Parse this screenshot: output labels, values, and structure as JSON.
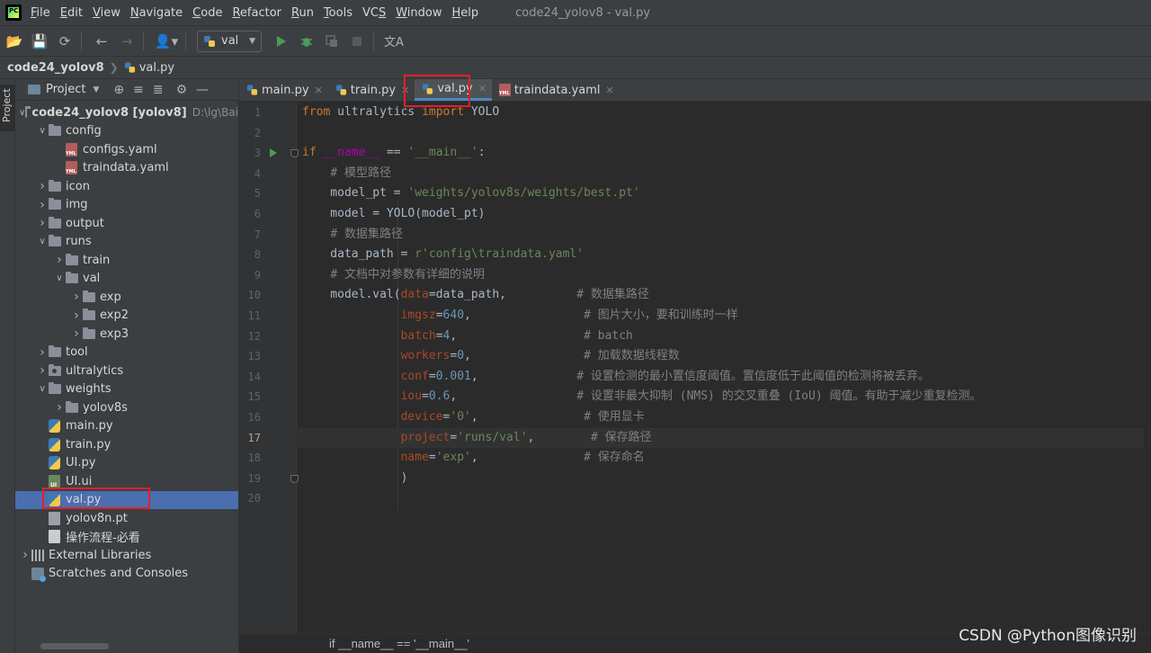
{
  "app": {
    "window_title": "code24_yolov8 - val.py"
  },
  "menu": {
    "items": [
      {
        "label": "File",
        "mn": "F",
        "rest": "ile"
      },
      {
        "label": "Edit",
        "mn": "E",
        "rest": "dit"
      },
      {
        "label": "View",
        "mn": "V",
        "rest": "iew"
      },
      {
        "label": "Navigate",
        "mn": "N",
        "rest": "avigate"
      },
      {
        "label": "Code",
        "mn": "C",
        "rest": "ode"
      },
      {
        "label": "Refactor",
        "mn": "R",
        "rest": "efactor"
      },
      {
        "label": "Run",
        "mn": "R",
        "rest": "un"
      },
      {
        "label": "Tools",
        "mn": "T",
        "rest": "ools"
      },
      {
        "label": "VCS",
        "mn": "S",
        "rest": "VC"
      },
      {
        "label": "Window",
        "mn": "W",
        "rest": "indow"
      },
      {
        "label": "Help",
        "mn": "H",
        "rest": "elp"
      }
    ]
  },
  "toolbar": {
    "run_config": "val"
  },
  "breadcrumb": {
    "project": "code24_yolov8",
    "file": "val.py"
  },
  "left_strip": {
    "project_label": "Project"
  },
  "project_panel": {
    "title": "Project",
    "tree": [
      {
        "label": "code24_yolov8 [yolov8]",
        "path": "D:\\lg\\Bai",
        "depth": 0,
        "arrow": "open",
        "icon": "folder",
        "bold": true
      },
      {
        "label": "config",
        "depth": 1,
        "arrow": "open",
        "icon": "folder"
      },
      {
        "label": "configs.yaml",
        "depth": 2,
        "arrow": "none",
        "icon": "yaml"
      },
      {
        "label": "traindata.yaml",
        "depth": 2,
        "arrow": "none",
        "icon": "yaml"
      },
      {
        "label": "icon",
        "depth": 1,
        "arrow": "closed",
        "icon": "folder"
      },
      {
        "label": "img",
        "depth": 1,
        "arrow": "closed",
        "icon": "folder"
      },
      {
        "label": "output",
        "depth": 1,
        "arrow": "closed",
        "icon": "folder"
      },
      {
        "label": "runs",
        "depth": 1,
        "arrow": "open",
        "icon": "folder"
      },
      {
        "label": "train",
        "depth": 2,
        "arrow": "closed",
        "icon": "folder"
      },
      {
        "label": "val",
        "depth": 2,
        "arrow": "open",
        "icon": "folder"
      },
      {
        "label": "exp",
        "depth": 3,
        "arrow": "closed",
        "icon": "folder"
      },
      {
        "label": "exp2",
        "depth": 3,
        "arrow": "closed",
        "icon": "folder"
      },
      {
        "label": "exp3",
        "depth": 3,
        "arrow": "closed",
        "icon": "folder"
      },
      {
        "label": "tool",
        "depth": 1,
        "arrow": "closed",
        "icon": "folder"
      },
      {
        "label": "ultralytics",
        "depth": 1,
        "arrow": "closed",
        "icon": "package"
      },
      {
        "label": "weights",
        "depth": 1,
        "arrow": "open",
        "icon": "folder"
      },
      {
        "label": "yolov8s",
        "depth": 2,
        "arrow": "closed",
        "icon": "folder"
      },
      {
        "label": "main.py",
        "depth": 1,
        "arrow": "none",
        "icon": "py"
      },
      {
        "label": "train.py",
        "depth": 1,
        "arrow": "none",
        "icon": "py"
      },
      {
        "label": "UI.py",
        "depth": 1,
        "arrow": "none",
        "icon": "py"
      },
      {
        "label": "UI.ui",
        "depth": 1,
        "arrow": "none",
        "icon": "ui"
      },
      {
        "label": "val.py",
        "depth": 1,
        "arrow": "none",
        "icon": "py",
        "selected": true
      },
      {
        "label": "yolov8n.pt",
        "depth": 1,
        "arrow": "none",
        "icon": "bin"
      },
      {
        "label": "操作流程-必看",
        "depth": 1,
        "arrow": "none",
        "icon": "txt"
      },
      {
        "label": "External Libraries",
        "depth": 0,
        "arrow": "closed",
        "icon": "lib"
      },
      {
        "label": "Scratches and Consoles",
        "depth": 0,
        "arrow": "none",
        "icon": "scratch"
      }
    ]
  },
  "editor": {
    "tabs": [
      {
        "label": "main.py",
        "icon": "py",
        "active": false
      },
      {
        "label": "train.py",
        "icon": "py",
        "active": false
      },
      {
        "label": "val.py",
        "icon": "py",
        "active": true
      },
      {
        "label": "traindata.yaml",
        "icon": "yaml",
        "active": false
      }
    ],
    "current_line": 17,
    "line_count": 20,
    "lines": [
      [
        {
          "t": "from ",
          "c": "kw"
        },
        {
          "t": "ultralytics "
        },
        {
          "t": "import ",
          "c": "kw"
        },
        {
          "t": "YOLO"
        }
      ],
      [],
      [
        {
          "t": "if ",
          "c": "kw"
        },
        {
          "t": "__name__ ",
          "c": "dunder"
        },
        {
          "t": "== "
        },
        {
          "t": "'__main__'",
          "c": "str"
        },
        {
          "t": ":"
        }
      ],
      [
        {
          "t": "    "
        },
        {
          "t": "# 模型路径",
          "c": "cmt"
        }
      ],
      [
        {
          "t": "    model_pt = "
        },
        {
          "t": "'weights/yolov8s/weights/best.pt'",
          "c": "str"
        }
      ],
      [
        {
          "t": "    model = YOLO(model_pt)"
        }
      ],
      [
        {
          "t": "    "
        },
        {
          "t": "# 数据集路径",
          "c": "cmt"
        }
      ],
      [
        {
          "t": "    data_path = "
        },
        {
          "t": "r'config\\traindata.yaml'",
          "c": "str"
        }
      ],
      [
        {
          "t": "    "
        },
        {
          "t": "# 文档中对参数有详细的说明",
          "c": "cmt"
        }
      ],
      [
        {
          "t": "    model.val("
        },
        {
          "t": "data",
          "c": "param"
        },
        {
          "t": "=data_path,          "
        },
        {
          "t": "# 数据集路径",
          "c": "cmt"
        }
      ],
      [
        {
          "t": "              "
        },
        {
          "t": "imgsz",
          "c": "param"
        },
        {
          "t": "="
        },
        {
          "t": "640",
          "c": "num"
        },
        {
          "t": ",                "
        },
        {
          "t": "# 图片大小，要和训练时一样",
          "c": "cmt"
        }
      ],
      [
        {
          "t": "              "
        },
        {
          "t": "batch",
          "c": "param"
        },
        {
          "t": "="
        },
        {
          "t": "4",
          "c": "num"
        },
        {
          "t": ",                  "
        },
        {
          "t": "# batch",
          "c": "cmt"
        }
      ],
      [
        {
          "t": "              "
        },
        {
          "t": "workers",
          "c": "param"
        },
        {
          "t": "="
        },
        {
          "t": "0",
          "c": "num"
        },
        {
          "t": ",                "
        },
        {
          "t": "# 加载数据线程数",
          "c": "cmt"
        }
      ],
      [
        {
          "t": "              "
        },
        {
          "t": "conf",
          "c": "param"
        },
        {
          "t": "="
        },
        {
          "t": "0.001",
          "c": "num"
        },
        {
          "t": ",              "
        },
        {
          "t": "# 设置检测的最小置信度阈值。置信度低于此阈值的检测将被丢弃。",
          "c": "cmt"
        }
      ],
      [
        {
          "t": "              "
        },
        {
          "t": "iou",
          "c": "param"
        },
        {
          "t": "="
        },
        {
          "t": "0.6",
          "c": "num"
        },
        {
          "t": ",                 "
        },
        {
          "t": "# 设置非最大抑制 (NMS) 的交叉重叠 (IoU) 阈值。有助于减少重复检测。",
          "c": "cmt"
        }
      ],
      [
        {
          "t": "              "
        },
        {
          "t": "device",
          "c": "param"
        },
        {
          "t": "="
        },
        {
          "t": "'0'",
          "c": "str"
        },
        {
          "t": ",               "
        },
        {
          "t": "# 使用显卡",
          "c": "cmt"
        }
      ],
      [
        {
          "t": "              "
        },
        {
          "t": "project",
          "c": "param"
        },
        {
          "t": "="
        },
        {
          "t": "'runs/val'",
          "c": "str"
        },
        {
          "t": ",        "
        },
        {
          "t": "# 保存路径",
          "c": "cmt"
        }
      ],
      [
        {
          "t": "              "
        },
        {
          "t": "name",
          "c": "param"
        },
        {
          "t": "="
        },
        {
          "t": "'exp'",
          "c": "str"
        },
        {
          "t": ",               "
        },
        {
          "t": "# 保存命名",
          "c": "cmt"
        }
      ],
      [
        {
          "t": "              )"
        }
      ],
      []
    ]
  },
  "status": {
    "code_breadcrumb": "if __name__ == '__main__'"
  },
  "watermark": "CSDN @Python图像识别",
  "colors": {
    "keyword": "#cc7832",
    "string": "#6a8759",
    "number": "#6897bb",
    "comment": "#808080",
    "param": "#aa4926",
    "dunder": "#b200b2",
    "selection": "#4b6eaf",
    "highlight_box": "#e0202a",
    "run_green": "#499c54"
  }
}
